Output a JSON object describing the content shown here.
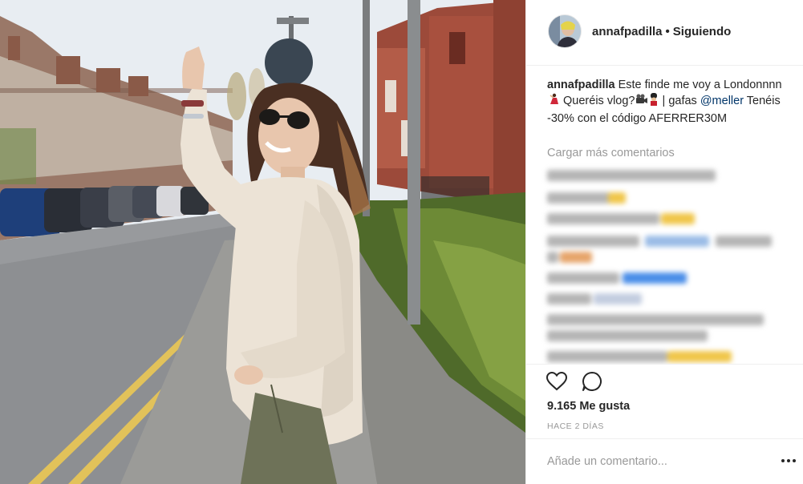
{
  "post": {
    "image_alt": "Woman in sunglasses and cream sweater waving on a street lined with brick houses"
  },
  "header": {
    "username": "annafpadilla",
    "separator": "•",
    "follow_status": "Siguiendo"
  },
  "caption": {
    "username": "annafpadilla",
    "text_1": "Este finde me voy a Londonnnn",
    "text_2": " Queréis vlog?",
    "text_3": " | gafas ",
    "mention": "@meller",
    "text_4": " Tenéis -30% con el código AFERRER30M"
  },
  "load_more": "Cargar más comentarios",
  "likes": "9.165 Me gusta",
  "date": "HACE 2 DÍAS",
  "comment_input": {
    "placeholder": "Añade un comentario..."
  },
  "icons": {
    "like": "heart-icon",
    "comment": "speech-bubble-icon",
    "more": "more-options-icon"
  },
  "colors": {
    "text": "#262626",
    "muted": "#999999",
    "mention": "#003569",
    "divider": "#efefef"
  }
}
